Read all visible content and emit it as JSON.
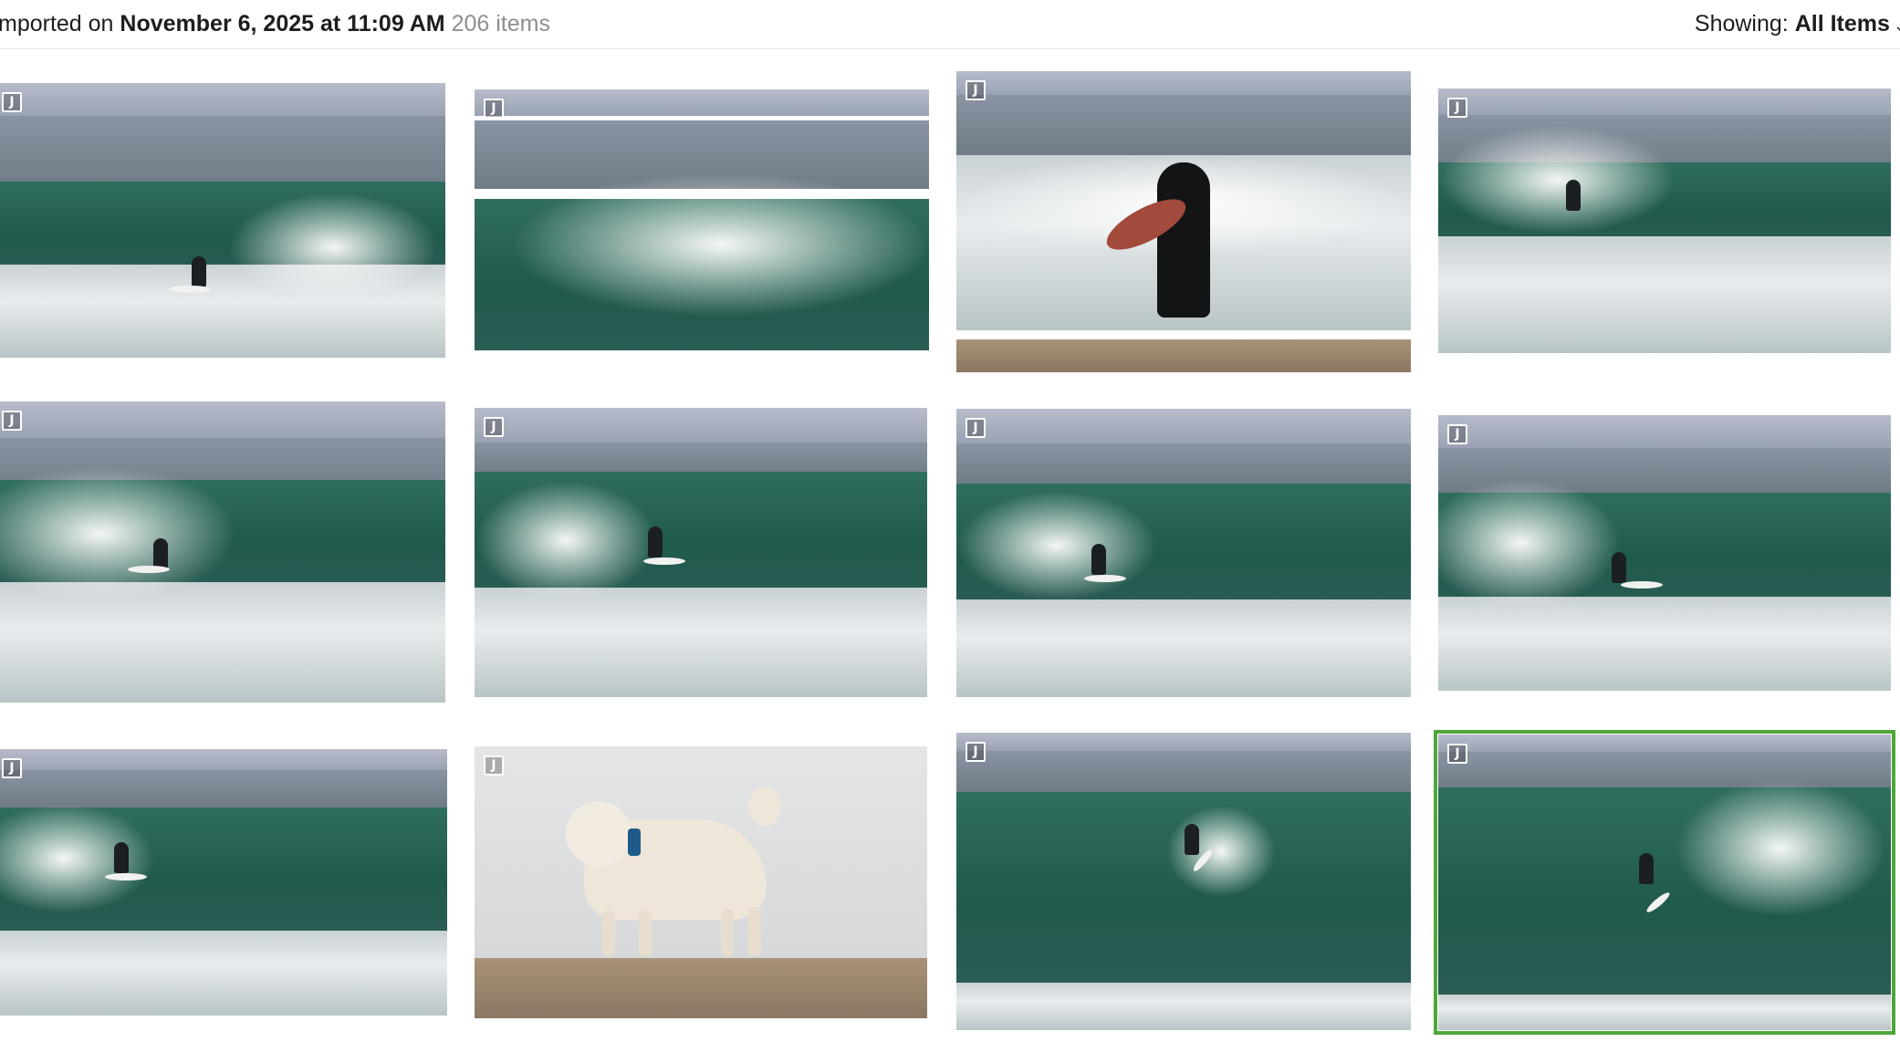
{
  "header": {
    "prefix": "mported on",
    "date": "November 6, 2025 at 11:09 AM",
    "count": "206 items",
    "filter_label": "Showing:",
    "filter_value": "All Items",
    "filter_chevron": "⌄"
  },
  "photos": [
    {
      "badge": "J",
      "subject": "surfer-riding-wave"
    },
    {
      "badge": "J",
      "subject": "breaking-wave"
    },
    {
      "badge": "J",
      "subject": "surfer-walking-with-board"
    },
    {
      "badge": "J",
      "subject": "surfer-on-wave"
    },
    {
      "badge": "J",
      "subject": "surfer-in-barrel"
    },
    {
      "badge": "J",
      "subject": "surfer-in-barrel"
    },
    {
      "badge": "J",
      "subject": "surfer-in-barrel"
    },
    {
      "badge": "J",
      "subject": "surfer-in-barrel"
    },
    {
      "badge": "J",
      "subject": "surfer-in-barrel"
    },
    {
      "badge": "J",
      "subject": "dog-on-beach"
    },
    {
      "badge": "J",
      "subject": "surfer-on-wave"
    },
    {
      "badge": "J",
      "subject": "surfer-on-wave",
      "selected": true
    }
  ],
  "colors": {
    "selection": "#4ea63a",
    "text": "#1d1d1f",
    "secondary_text": "#8e8e93"
  }
}
